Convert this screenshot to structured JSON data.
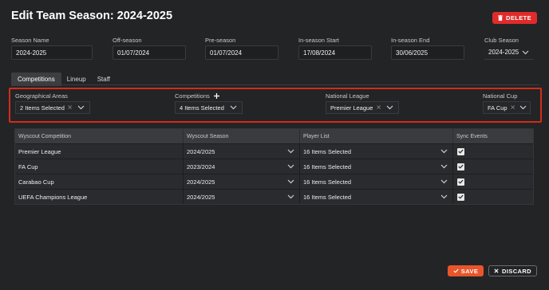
{
  "header": {
    "title": "Edit Team Season: 2024-2025",
    "delete_label": "DELETE"
  },
  "fields": {
    "season_name": {
      "label": "Season Name",
      "value": "2024-2025"
    },
    "off_season": {
      "label": "Off-season",
      "value": "01/07/2024"
    },
    "pre_season": {
      "label": "Pre-season",
      "value": "01/07/2024"
    },
    "in_season_start": {
      "label": "In-season Start",
      "value": "17/08/2024"
    },
    "in_season_end": {
      "label": "In-season End",
      "value": "30/06/2025"
    },
    "club_season": {
      "label": "Club Season",
      "value": "2024-2025"
    }
  },
  "tabs": [
    {
      "label": "Competitions",
      "active": true
    },
    {
      "label": "Lineup",
      "active": false
    },
    {
      "label": "Staff",
      "active": false
    }
  ],
  "filters": {
    "geo": {
      "label": "Geographical Areas",
      "value": "2 Items Selected"
    },
    "competitions": {
      "label": "Competitions",
      "value": "4 Items Selected"
    },
    "national_league": {
      "label": "National League",
      "value": "Premier League"
    },
    "national_cup": {
      "label": "National Cup",
      "value": "FA Cup"
    }
  },
  "table": {
    "headers": [
      "Wyscout Competition",
      "Wyscout Season",
      "Player List",
      "Sync Events"
    ],
    "rows": [
      {
        "competition": "Premier League",
        "season": "2024/2025",
        "players": "16 Items Selected",
        "sync": true
      },
      {
        "competition": "FA Cup",
        "season": "2023/2024",
        "players": "16 Items Selected",
        "sync": true
      },
      {
        "competition": "Carabao Cup",
        "season": "2024/2025",
        "players": "16 Items Selected",
        "sync": true
      },
      {
        "competition": "UEFA Champions League",
        "season": "2024/2025",
        "players": "16 Items Selected",
        "sync": true
      }
    ]
  },
  "footer": {
    "save_label": "SAVE",
    "discard_label": "DISCARD"
  },
  "colors": {
    "background": "#232426",
    "delete": "#e02b2b",
    "save": "#e8552a",
    "highlight_border": "#d32b1a"
  }
}
